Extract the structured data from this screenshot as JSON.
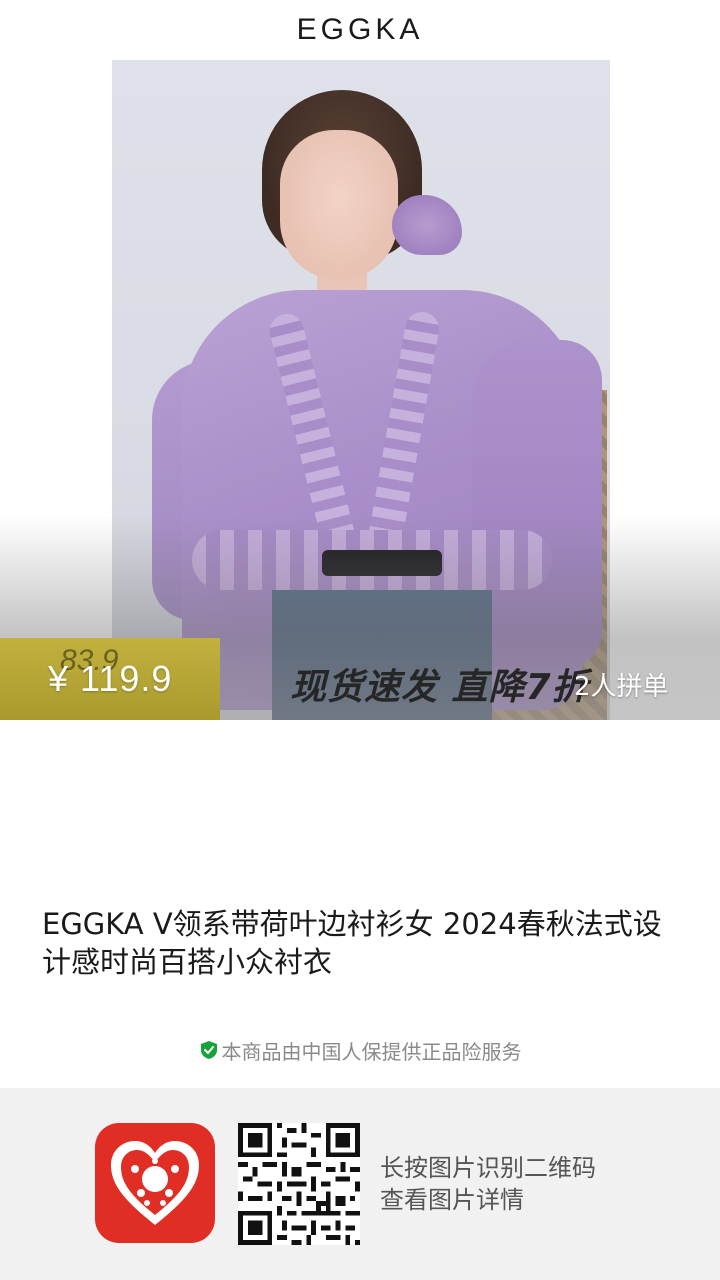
{
  "brand": {
    "name": "EGGKA"
  },
  "banner": {
    "price_current": "¥ 119.9",
    "price_ghost": "83.9",
    "promo_text": "现货速发  直降7折",
    "group_buy": "2人拼单"
  },
  "product": {
    "title": "EGGKA V领系带荷叶边衬衫女 2024春秋法式设计感时尚百搭小众衬衣"
  },
  "guarantee": {
    "text": "本商品由中国人保提供正品险服务",
    "icon": "shield-check-icon",
    "color": "#19a23a"
  },
  "footer": {
    "app_icon": "pinduoduo-logo",
    "qr_icon": "qr-code-icon",
    "hint_line1": "长按图片识别二维码",
    "hint_line2": "查看图片详情"
  },
  "colors": {
    "price_box": "#b8a836",
    "app_red": "#e02e24",
    "blouse": "#a98ec9"
  }
}
